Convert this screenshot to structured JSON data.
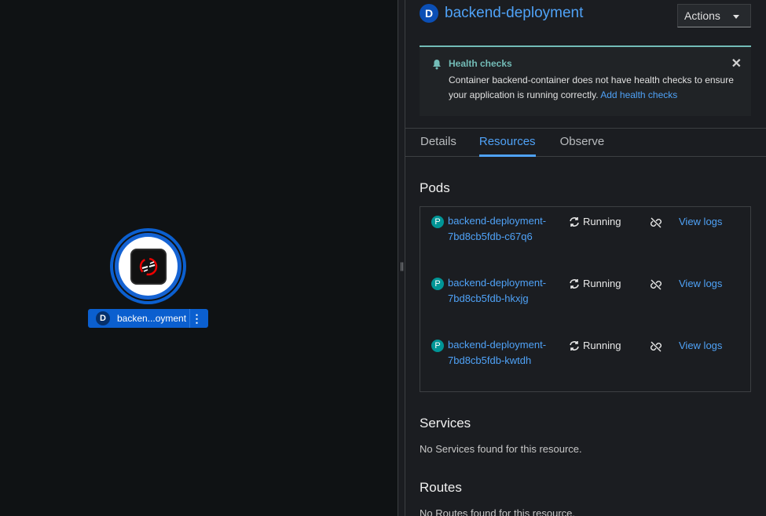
{
  "topology": {
    "node": {
      "badge": "D",
      "label": "backen...oyment",
      "kebab": "⋮"
    }
  },
  "panel": {
    "badge": "D",
    "title": "backend-deployment",
    "actions_label": "Actions",
    "alert": {
      "title": "Health checks",
      "body": "Container backend-container does not have health checks to ensure your application is running correctly.",
      "link": "Add health checks",
      "close": "✕"
    },
    "tabs": [
      {
        "label": "Details"
      },
      {
        "label": "Resources"
      },
      {
        "label": "Observe"
      }
    ],
    "active_tab": "Resources",
    "pods_title": "Pods",
    "pods": [
      {
        "badge": "P",
        "name": "backend-deployment-7bd8cb5fdb-c67q6",
        "status": "Running",
        "logs": "View logs"
      },
      {
        "badge": "P",
        "name": "backend-deployment-7bd8cb5fdb-hkxjg",
        "status": "Running",
        "logs": "View logs"
      },
      {
        "badge": "P",
        "name": "backend-deployment-7bd8cb5fdb-kwtdh",
        "status": "Running",
        "logs": "View logs"
      }
    ],
    "services_title": "Services",
    "services_empty": "No Services found for this resource.",
    "routes_title": "Routes",
    "routes_empty": "No Routes found for this resource."
  },
  "colors": {
    "accent": "#4fa2f7",
    "node_blue": "#0b5fcf",
    "alert_teal": "#73bcb7",
    "pod_badge": "#009596"
  }
}
